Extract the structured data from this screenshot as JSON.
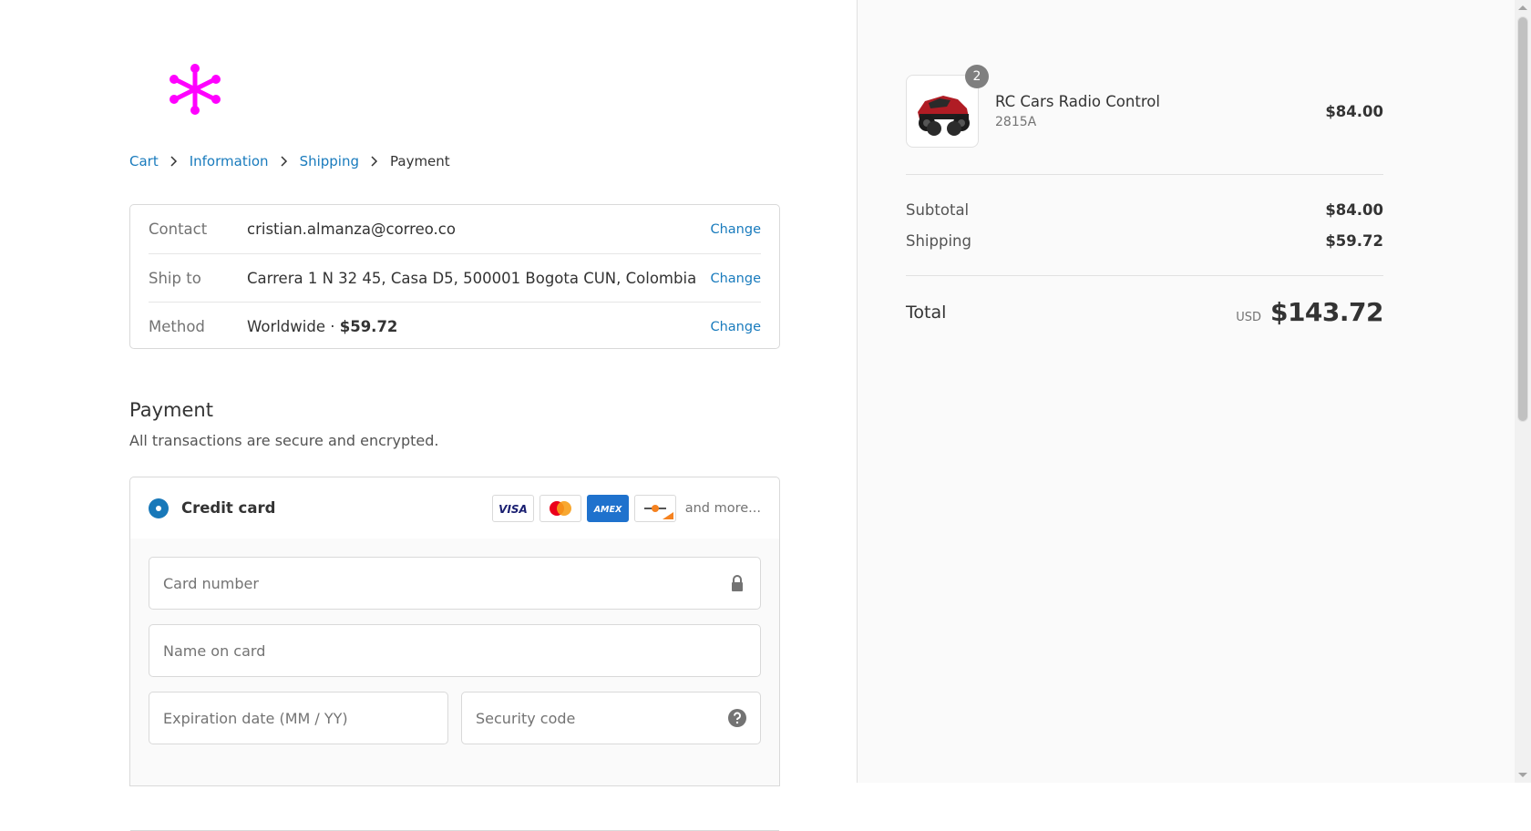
{
  "breadcrumb": {
    "cart": "Cart",
    "information": "Information",
    "shipping": "Shipping",
    "payment": "Payment"
  },
  "review": {
    "contact_label": "Contact",
    "contact_value": "cristian.almanza@correo.co",
    "ship_label": "Ship to",
    "ship_value": "Carrera 1 N 32 45, Casa D5, 500001 Bogota CUN, Colombia",
    "method_label": "Method",
    "method_value": "Worldwide · ",
    "method_price": "$59.72",
    "change_label": "Change"
  },
  "payment": {
    "title": "Payment",
    "subtitle": "All transactions are secure and encrypted.",
    "credit_card_label": "Credit card",
    "and_more": "and more...",
    "card_number_placeholder": "Card number",
    "name_placeholder": "Name on card",
    "expiry_placeholder": "Expiration date (MM / YY)",
    "security_placeholder": "Security code",
    "brand_color": "#1878b9"
  },
  "order": {
    "product_name": "RC Cars Radio Control",
    "product_variant": "2815A",
    "product_price": "$84.00",
    "quantity": "2",
    "subtotal_label": "Subtotal",
    "subtotal_value": "$84.00",
    "shipping_label": "Shipping",
    "shipping_value": "$59.72",
    "total_label": "Total",
    "currency": "USD",
    "total_value": "$143.72"
  },
  "icons": {
    "logo": "asterisk-logo",
    "lock": "lock-icon",
    "help": "question-icon"
  }
}
